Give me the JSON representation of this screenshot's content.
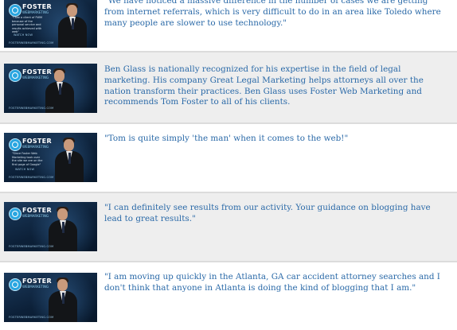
{
  "brand": {
    "logo_text": "FOSTER",
    "logo_sub": "WEBMARKETING",
    "footer": "FOSTERWEBMARKETING.COM",
    "accent_color": "#2aa6e0",
    "text_color": "#2b6aa8"
  },
  "testimonials": [
    {
      "text": "\"We have noticed a massive difference in the number of cases we are getting from internet referrals, which is very difficult to do in an area like Toledo where many people are slower to use technology.\"",
      "thumb_caption": "\"I see a client of FWM because of the personal service and results achieved with web\"",
      "thumb_cta": "WATCH NOW"
    },
    {
      "text": "Ben Glass is nationally recognized for his expertise in the field of legal marketing. His company Great Legal Marketing helps attorneys all over the nation transform their practices. Ben Glass uses Foster Web Marketing and recommends Tom Foster to all of his clients.",
      "thumb_caption": "",
      "thumb_cta": ""
    },
    {
      "text": "\"Tom is quite simply 'the man' when it comes to the web!\"",
      "thumb_caption": "\"Since Foster Web Marketing took over the site we are on the first page of Google\"",
      "thumb_cta": "WATCH NOW"
    },
    {
      "text": "\"I can definitely see results from our activity. Your guidance on blogging have lead to great results.\"",
      "thumb_caption": "",
      "thumb_cta": ""
    },
    {
      "text": "\"I am moving up quickly in the Atlanta, GA car accident attorney searches and I don't think that anyone in Atlanta is doing the kind of blogging that I am.\"",
      "thumb_caption": "",
      "thumb_cta": ""
    }
  ]
}
